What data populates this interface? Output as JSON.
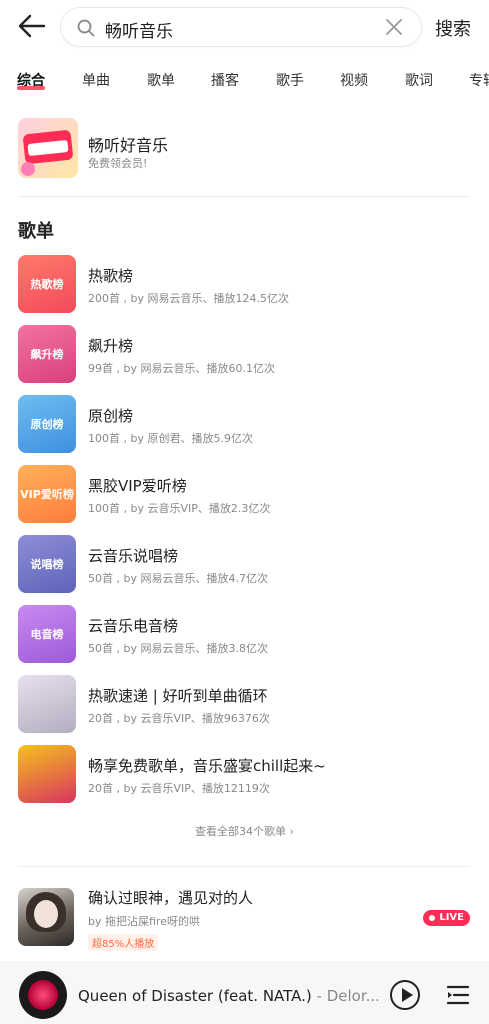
{
  "search": {
    "query": "畅听音乐",
    "button": "搜索"
  },
  "tabs": [
    "综合",
    "单曲",
    "歌单",
    "播客",
    "歌手",
    "视频",
    "歌词",
    "专辑"
  ],
  "active_tab": "综合",
  "promo": {
    "title": "畅听好音乐",
    "subtitle": "免费领会员!"
  },
  "section": {
    "title": "歌单"
  },
  "playlists": [
    {
      "name": "热歌榜",
      "meta": "200首 , by 网易云音乐、播放124.5亿次",
      "cover_label": "热歌榜",
      "color_a": "#ff7a6b",
      "color_b": "#f24a5a"
    },
    {
      "name": "飙升榜",
      "meta": "99首 , by 网易云音乐、播放60.1亿次",
      "cover_label": "飙升榜",
      "color_a": "#f2739f",
      "color_b": "#d8407e"
    },
    {
      "name": "原创榜",
      "meta": "100首 , by 原创君、播放5.9亿次",
      "cover_label": "原创榜",
      "color_a": "#6fbdf0",
      "color_b": "#3f8fe0"
    },
    {
      "name": "黑胶VIP爱听榜",
      "meta": "100首 , by 云音乐VIP、播放2.3亿次",
      "cover_label": "VIP爱听榜",
      "color_a": "#ffb15c",
      "color_b": "#ff7d3a"
    },
    {
      "name": "云音乐说唱榜",
      "meta": "50首 , by 网易云音乐、播放4.7亿次",
      "cover_label": "说唱榜",
      "color_a": "#8d8ed8",
      "color_b": "#5e63b8"
    },
    {
      "name": "云音乐电音榜",
      "meta": "50首 , by 网易云音乐、播放3.8亿次",
      "cover_label": "电音榜",
      "color_a": "#c98af0",
      "color_b": "#9c5ad9"
    },
    {
      "name": "热歌速递 | 好听到单曲循环",
      "meta": "20首 , by 云音乐VIP、播放96376次",
      "cover_label": "",
      "color_a": "#e6e0ee",
      "color_b": "#b3aec0"
    },
    {
      "name": "畅享免费歌单，音乐盛宴chill起来~",
      "meta": "20首 , by 云音乐VIP、播放12119次",
      "cover_label": "",
      "color_a": "#f5c21b",
      "color_b": "#d8345f"
    }
  ],
  "view_all": "查看全部34个歌单 ›",
  "live": {
    "title": "确认过眼神，遇见对的人",
    "by": "by 拖把沾屎fire呀的哄",
    "badge": "超85%人播放",
    "tag": "LIVE"
  },
  "player": {
    "song": "Queen of Disaster (feat. NATA.)",
    "artist": " - Delor..."
  }
}
